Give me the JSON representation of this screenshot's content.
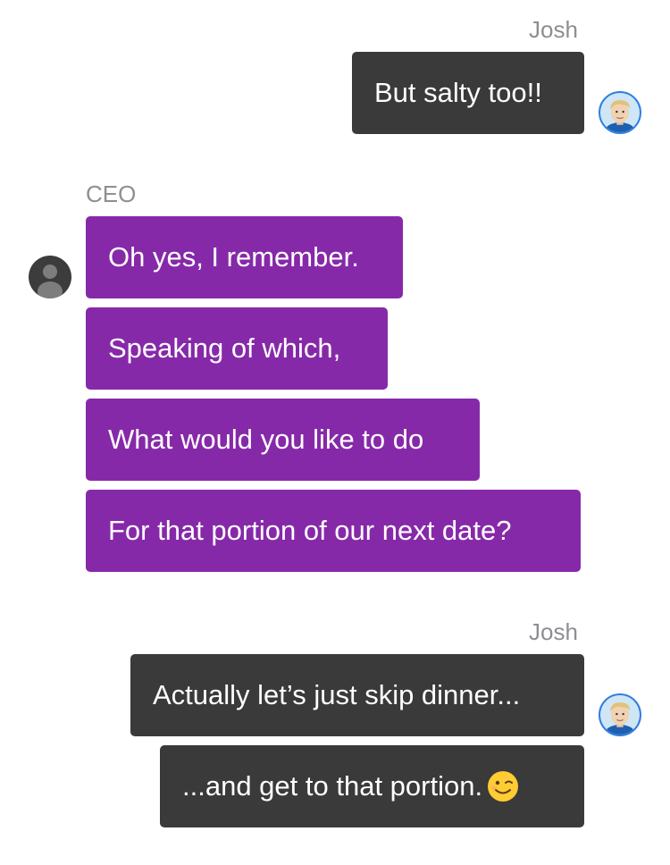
{
  "conversation": {
    "group1": {
      "sender": "Josh",
      "messages": [
        "But salty too!!"
      ],
      "avatar_icon": "josh-avatar-icon"
    },
    "group2": {
      "sender": "CEO",
      "messages": [
        "Oh yes, I remember.",
        "Speaking of which,",
        "What would you like to do",
        "For that portion of our next date?"
      ],
      "avatar_icon": "person-silhouette-icon"
    },
    "group3": {
      "sender": "Josh",
      "messages": [
        "Actually let’s just skip dinner...",
        "...and get to that portion."
      ],
      "emoji": "winking-face-emoji-icon",
      "avatar_icon": "josh-avatar-icon"
    }
  },
  "colors": {
    "outgoing_bubble": "#3a3a3a",
    "incoming_bubble": "#8629a9",
    "sender_name": "#8e8e93"
  }
}
